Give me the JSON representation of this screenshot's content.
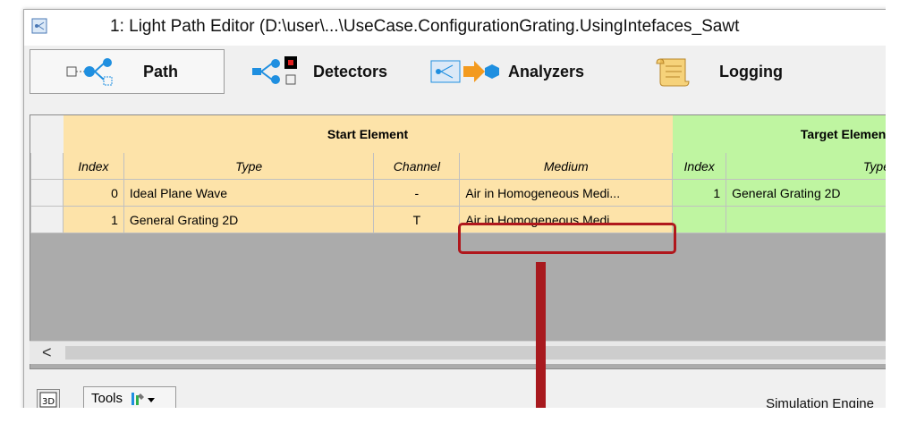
{
  "window": {
    "title": "1: Light Path Editor (D:\\user\\...\\UseCase.ConfigurationGrating.UsingIntefaces_Sawt"
  },
  "tabs": [
    {
      "label": "Path",
      "icon": "path-icon",
      "active": true
    },
    {
      "label": "Detectors",
      "icon": "detectors-icon",
      "active": false
    },
    {
      "label": "Analyzers",
      "icon": "analyzers-icon",
      "active": false
    },
    {
      "label": "Logging",
      "icon": "logging-scroll-icon",
      "active": false
    }
  ],
  "grid": {
    "groups": {
      "start": "Start Element",
      "target": "Target Element"
    },
    "columns": {
      "index": "Index",
      "type": "Type",
      "channel": "Channel",
      "medium": "Medium",
      "target_index": "Index",
      "target_type": "Type"
    },
    "rows": [
      {
        "index": "0",
        "type": "Ideal Plane Wave",
        "channel": "-",
        "medium": "Air in Homogeneous Medi...",
        "target_index": "1",
        "target_type": "General Grating 2D"
      },
      {
        "index": "1",
        "type": "General Grating 2D",
        "channel": "T",
        "medium": "Air in Homogeneous Medi...",
        "target_index": "",
        "target_type": ""
      }
    ]
  },
  "scrollbar": {
    "left_arrow": "<"
  },
  "status_bar": {
    "tools_label": "Tools",
    "engine_label": "Simulation Engine"
  },
  "colors": {
    "start_group": "#fde3a9",
    "target_group": "#bff5a1",
    "highlight": "#b0171c"
  }
}
